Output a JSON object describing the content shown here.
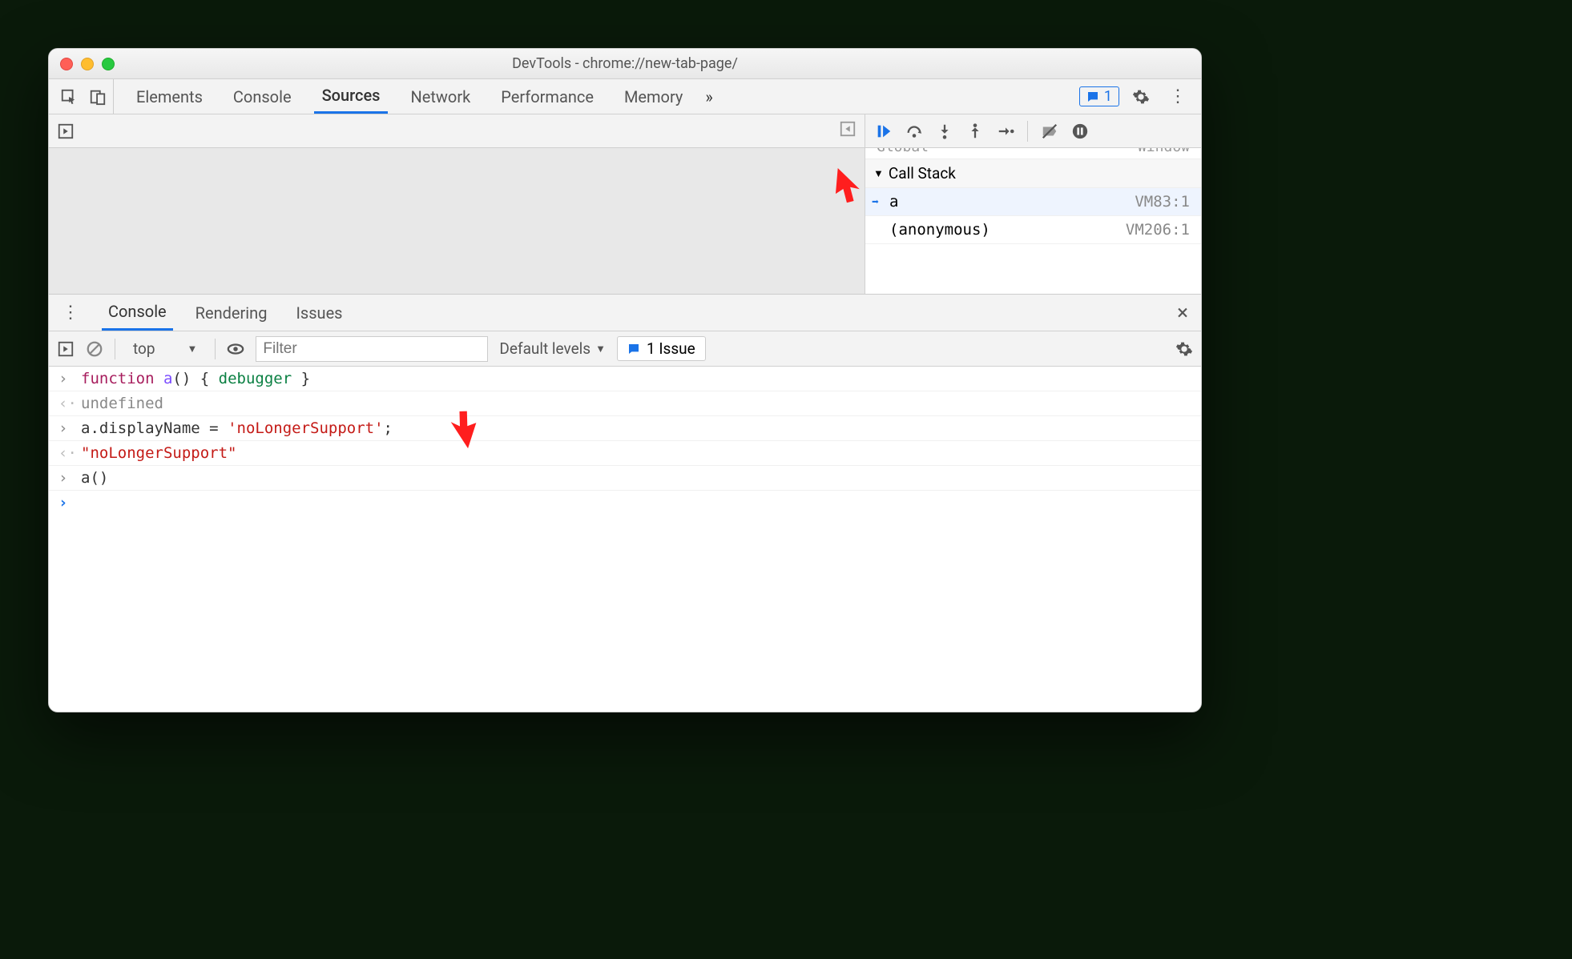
{
  "window": {
    "title": "DevTools - chrome://new-tab-page/"
  },
  "mainTabs": {
    "items": [
      "Elements",
      "Console",
      "Sources",
      "Network",
      "Performance",
      "Memory"
    ],
    "active": "Sources",
    "overflow": "»"
  },
  "badge": {
    "count": "1"
  },
  "debugger": {
    "globalScope": {
      "label": "Global",
      "value": "Window"
    },
    "callStackHeader": "Call Stack",
    "stack": [
      {
        "name": "a",
        "location": "VM83:1",
        "active": true
      },
      {
        "name": "(anonymous)",
        "location": "VM206:1",
        "active": false
      }
    ]
  },
  "drawer": {
    "tabs": [
      "Console",
      "Rendering",
      "Issues"
    ],
    "active": "Console"
  },
  "consoleToolbar": {
    "context": "top",
    "filterPlaceholder": "Filter",
    "levels": "Default levels",
    "issueButton": "1 Issue"
  },
  "consoleLines": {
    "l1": {
      "kw": "function",
      "fn": "a",
      "rest": "() { ",
      "dbg": "debugger",
      "end": " }"
    },
    "l2": "undefined",
    "l3": {
      "obj": "a",
      "prop": ".displayName",
      "eq": " = ",
      "str": "'noLongerSupport'",
      "semi": ";"
    },
    "l4": "\"noLongerSupport\"",
    "l5": "a()"
  }
}
